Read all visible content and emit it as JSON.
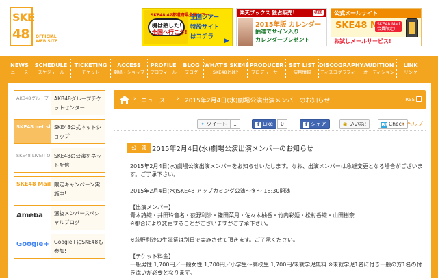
{
  "header": {
    "logo": {
      "line1": "SKE",
      "line2": "48",
      "sub1": "OFFICIAL",
      "sub2": "WEB SITE"
    },
    "banners": [
      {
        "art_top": "SKE48 47都道府県全国ツアー",
        "art_line1": "機は熟した!",
        "art_line2": "全国へ行こう!",
        "lines": [
          "全国ツアー",
          "特設サイト",
          "はコチラ"
        ],
        "arrow": "▶"
      },
      {
        "top": "楽天ブックス 独占販売!",
        "corner": "初回",
        "line1": "2015年版 カレンダー",
        "line2": "抽選でサイン入り",
        "line3": "カレンダープレゼント"
      },
      {
        "top": "公式メールサイト",
        "title": "SKE48 Mail",
        "badge1": "SKE48 Mail",
        "badge2": "会員限定!!",
        "bottom": "お試しメールサービス!"
      }
    ]
  },
  "nav": [
    {
      "en": "NEWS",
      "ja": "ニュース",
      "w": 34
    },
    {
      "en": "SCHEDULE",
      "ja": "スケジュール",
      "w": 58
    },
    {
      "en": "TICKETING",
      "ja": "チケット",
      "w": 58
    },
    {
      "en": "ACCESS",
      "ja": "劇場・ショップ",
      "w": 54
    },
    {
      "en": "PROFILE",
      "ja": "プロフィール",
      "w": 46
    },
    {
      "en": "BLOG",
      "ja": "ブログ",
      "w": 36
    },
    {
      "en": "WHAT'S SKE48",
      "ja": "SKE48とは?",
      "w": 64
    },
    {
      "en": "PRODUCER",
      "ja": "プロデューサー",
      "w": 56
    },
    {
      "en": "SET LIST",
      "ja": "演目情報",
      "w": 48
    },
    {
      "en": "DISCOGRAPHY",
      "ja": "ディスコグラフィー",
      "w": 62
    },
    {
      "en": "AUDITION",
      "ja": "オーディション",
      "w": 52
    },
    {
      "en": "LINK",
      "ja": "リンク",
      "w": 40
    }
  ],
  "sidebar": [
    {
      "thumb": "AKB48グループ チケットセンター",
      "label": "AKB48グループチケットセンター",
      "style": "plain"
    },
    {
      "thumb": "SKE48 net shop",
      "label": "SKE48公式ネットショップ",
      "style": "orange"
    },
    {
      "thumb": "SKE48 LIVE!! ON DEMAND",
      "label": "SKE48の公演をネット配信",
      "style": "plain"
    },
    {
      "thumb": "SKE48 Mail",
      "label": "限定キャンペーン実施中!",
      "style": "white"
    },
    {
      "thumb": "Ameba",
      "label": "選抜メンバースペシャルブログ",
      "style": "ameba"
    },
    {
      "thumb": "Google+",
      "label": "Google+にSKE48も参加!",
      "style": "google"
    }
  ],
  "breadcrumb": {
    "news": "ニュース",
    "title": "2015年2月4日(水)劇場公演出演メンバーのお知らせ",
    "rss": "RSS"
  },
  "social": {
    "tweet": "ツイート",
    "tweet_count": "1",
    "like": "Like",
    "like_count": "0",
    "share": "シェア",
    "iine": "いいね!",
    "check": "Check",
    "help": "←ヘルプ"
  },
  "article": {
    "category": "公　演",
    "title": "2015年2月4日(水)劇場公演出演メンバーのお知らせ",
    "p1": "2015年2月4日(水)劇場公演出演メンバーをお知らせいたします。なお、出演メンバーは急遽変更となる場合がございます。ご了承下さい。",
    "p2": "2015年2月4日(水)SKE48 アップカミング公演〜冬〜 18:30開演",
    "members_head": "【出演メンバー】",
    "members": "青木詩織・井田玲音名・荻野利沙・鎌田菜月・佐々木柚香・竹内彩姫・松村香織・山田樹奈",
    "members_note": "※都合により変更することがございますがご了承下さい。",
    "p3": "※荻野利沙の生誕祭は別日で実施させて頂きます。ご了承ください。",
    "ticket_head": "【チケット料金】",
    "ticket": "一般男性 1,700円／一般女性 1,700円／小学生〜高校生 1,700円/未就学児無料 ※未就学児1名に付き一般の方1名の付き添いが必要となります。"
  }
}
